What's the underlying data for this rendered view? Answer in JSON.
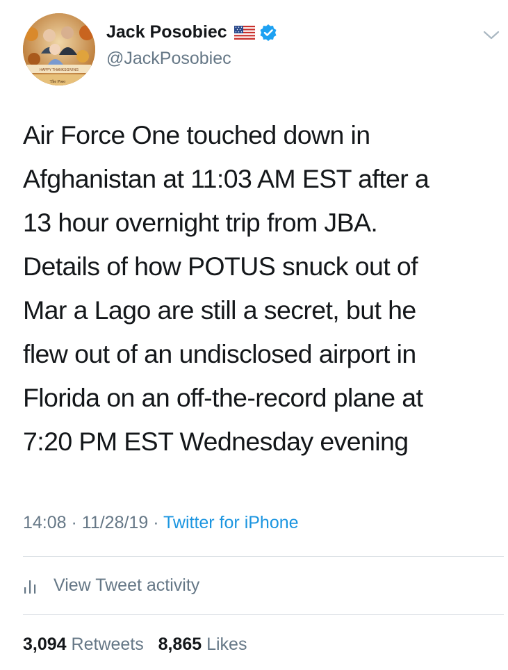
{
  "user": {
    "display_name": "Jack Posobiec",
    "handle": "@JackPosobiec",
    "flag_icon": "us-flag-icon",
    "verified_icon": "verified-badge-icon",
    "avatar_banner_text": "HAPPY THANKSGIVING",
    "avatar_footer_text": "The Poso"
  },
  "tweet": {
    "text_lines": [
      "Air Force One touched down in",
      "Afghanistan at 11:03 AM EST after a",
      "13 hour overnight trip from JBA.",
      "Details of how POTUS snuck out of",
      "Mar a Lago are still a secret, but he",
      "flew out of an undisclosed airport in",
      "Florida on an off-the-record plane at",
      "7:20 PM EST Wednesday evening"
    ]
  },
  "meta": {
    "time": "14:08",
    "separator": " · ",
    "date": "11/28/19",
    "source": "Twitter for iPhone"
  },
  "activity": {
    "label": "View Tweet activity",
    "icon": "bar-chart-icon"
  },
  "stats": {
    "retweets_count": "3,094",
    "retweets_label": "Retweets",
    "likes_count": "8,865",
    "likes_label": "Likes"
  },
  "colors": {
    "text": "#14171a",
    "secondary": "#657786",
    "link": "#1b95e0",
    "verified": "#1da1f2",
    "divider": "#d6dce1"
  }
}
